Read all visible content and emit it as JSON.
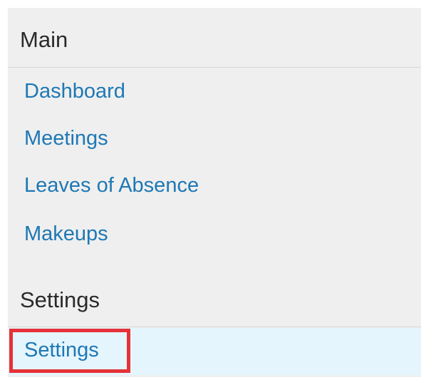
{
  "nav": {
    "main_section_title": "Main",
    "main_items": [
      {
        "label": "Dashboard"
      },
      {
        "label": "Meetings"
      },
      {
        "label": "Leaves of Absence"
      },
      {
        "label": "Makeups"
      }
    ],
    "settings_section_title": "Settings",
    "settings_items": [
      {
        "label": "Settings",
        "highlighted": true
      }
    ]
  },
  "colors": {
    "link": "#1e78b4",
    "panel_background": "#efefef",
    "selected_row_background": "#e5f5fd",
    "highlight_border": "#e53238"
  }
}
